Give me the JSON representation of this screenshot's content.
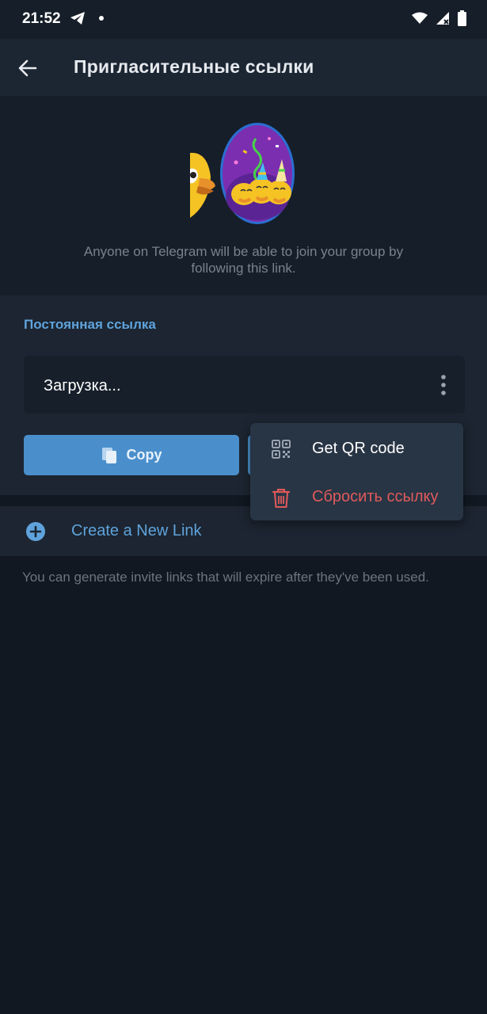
{
  "status_bar": {
    "time": "21:52"
  },
  "app_bar": {
    "title": "Пригласительные ссылки"
  },
  "hero": {
    "description": "Anyone on Telegram will be able to join your group by following this link."
  },
  "permanent_link": {
    "header": "Постоянная ссылка",
    "link_value": "Загрузка...",
    "copy_label": "Copy"
  },
  "create_link": {
    "label": "Create a New Link"
  },
  "footer": {
    "hint": "You can generate invite links that will expire after they've been used."
  },
  "popup_menu": {
    "items": [
      {
        "label": "Get QR code",
        "icon": "qr-code-icon"
      },
      {
        "label": "Сбросить ссылку",
        "icon": "trash-icon"
      }
    ]
  },
  "colors": {
    "accent": "#5fa3dc",
    "button": "#4a8fcc",
    "danger": "#e05a5a",
    "background": "#111821"
  }
}
